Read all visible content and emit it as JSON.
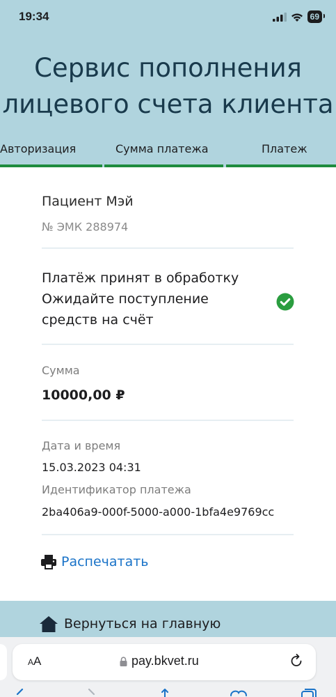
{
  "status_bar": {
    "time": "19:34",
    "battery": "69"
  },
  "header": {
    "title_line1": "Сервис пополнения",
    "title_line2": "лицевого счета клиента"
  },
  "steps": [
    {
      "label": "Авторизация"
    },
    {
      "label": "Сумма платежа"
    },
    {
      "label": "Платеж"
    }
  ],
  "patient": {
    "name": "Пациент Мэй",
    "emk": "№ ЭМК 288974"
  },
  "payment_status": {
    "line1": "Платёж принят в обработку",
    "line2": "Ожидайте поступление",
    "line3": "средств на счёт"
  },
  "amount": {
    "label": "Сумма",
    "value": "10000,00 ₽"
  },
  "datetime": {
    "label": "Дата и время",
    "value": "15.03.2023 04:31"
  },
  "payment_id": {
    "label": "Идентификатор платежа",
    "value": "2ba406a9-000f-5000-a000-1bfa4e9769cc"
  },
  "actions": {
    "print_label": "Распечатать",
    "back_label": "Вернуться на главную"
  },
  "browser": {
    "aa_small": "A",
    "aa_large": "A",
    "url": "pay.bkvet.ru"
  },
  "colors": {
    "header_bg": "#b0d4de",
    "title": "#193a4c",
    "step_bar": "#1e8c3e",
    "link": "#1a73c8",
    "check": "#2a9d3f"
  }
}
